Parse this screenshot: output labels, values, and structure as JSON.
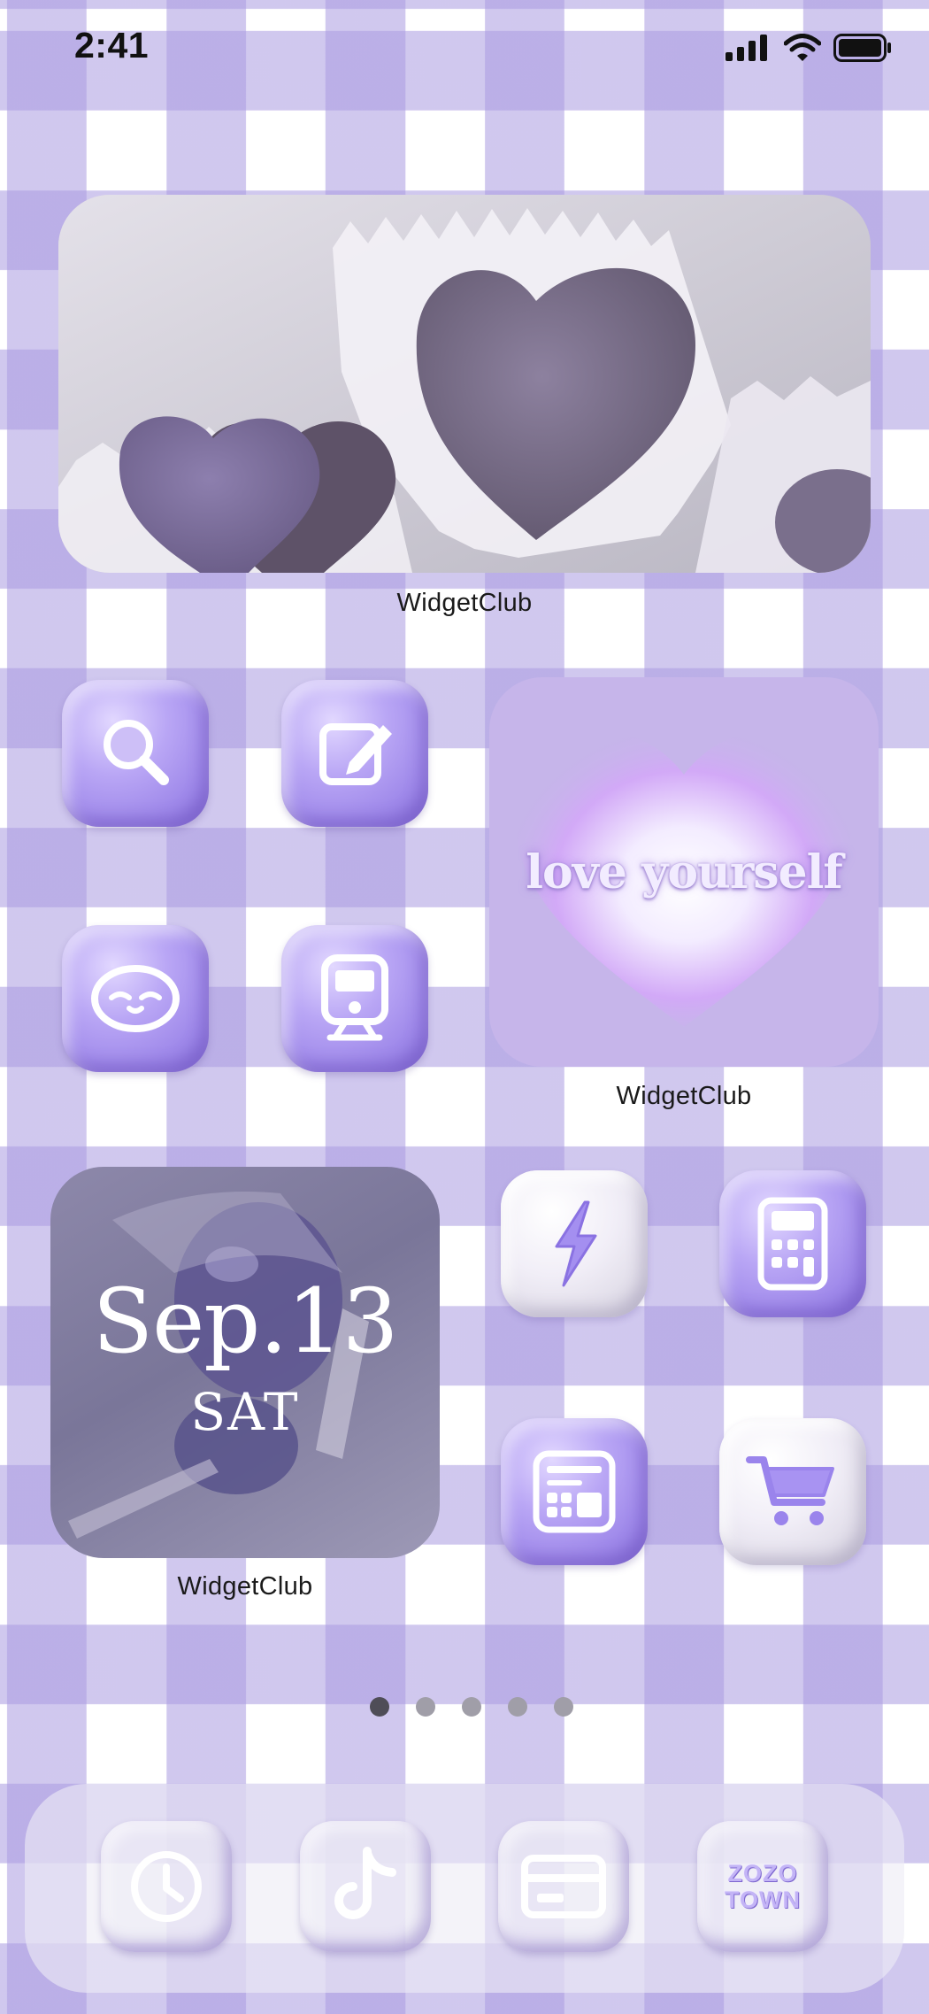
{
  "status_bar": {
    "time": "2:41"
  },
  "widgets": {
    "photo_widget": {
      "label": "WidgetClub"
    },
    "love_widget": {
      "text": "love yourself",
      "label": "WidgetClub"
    },
    "date_widget": {
      "date": "Sep.13",
      "day": "SAT",
      "label": "WidgetClub"
    }
  },
  "apps": [
    {
      "icon": "search-icon"
    },
    {
      "icon": "edit-note-icon"
    },
    {
      "icon": "character-face-icon"
    },
    {
      "icon": "train-icon"
    },
    {
      "icon": "lightning-icon"
    },
    {
      "icon": "calculator-icon"
    },
    {
      "icon": "layout-icon"
    },
    {
      "icon": "shopping-cart-icon"
    }
  ],
  "page_indicator": {
    "count": 5,
    "active_index": 0
  },
  "dock": {
    "apps": [
      {
        "icon": "clock-icon"
      },
      {
        "icon": "tiktok-icon"
      },
      {
        "icon": "wallet-card-icon"
      },
      {
        "icon": "zozotown-icon",
        "line1": "ZOZO",
        "line2": "TOWN"
      }
    ]
  },
  "colors": {
    "accent": "#a48ff0",
    "gingham": "#c9bfef",
    "label_text": "#1a1a1a"
  }
}
